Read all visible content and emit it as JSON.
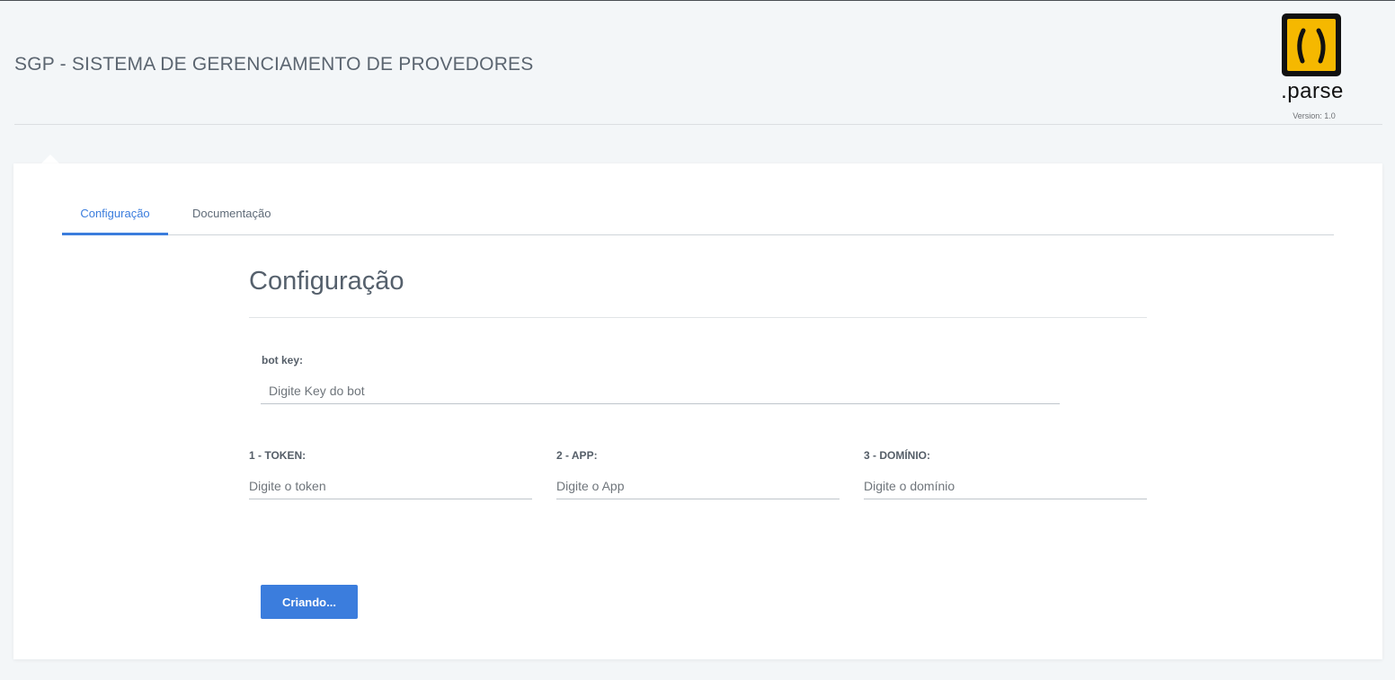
{
  "header": {
    "title": "SGP - SISTEMA DE GERENCIAMENTO DE PROVEDORES",
    "logo_text": ".parse",
    "version": "Version: 1.0"
  },
  "tabs": [
    {
      "label": "Configuração",
      "active": true
    },
    {
      "label": "Documentação",
      "active": false
    }
  ],
  "section": {
    "title": "Configuração"
  },
  "form": {
    "bot_key": {
      "label": "bot key:",
      "placeholder": "Digite Key do bot",
      "value": ""
    },
    "token": {
      "label": "1 - TOKEN:",
      "placeholder": "Digite o token",
      "value": ""
    },
    "app": {
      "label": "2 - APP:",
      "placeholder": "Digite o App",
      "value": ""
    },
    "dominio": {
      "label": "3 - DOMÍNIO:",
      "placeholder": "Digite o domínio",
      "value": ""
    },
    "submit_label": "Criando..."
  },
  "colors": {
    "accent": "#3b7ddd",
    "logo_yellow": "#f5b800",
    "background": "#f3f6f8"
  }
}
